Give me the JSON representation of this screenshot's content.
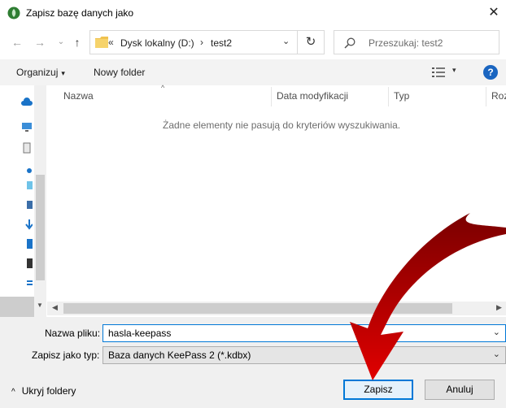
{
  "window": {
    "title": "Zapisz bazę danych jako",
    "close_glyph": "✕"
  },
  "address": {
    "overflow": "«",
    "crumbs": [
      "Dysk lokalny (D:)",
      "test2"
    ],
    "separator": "›",
    "dropdown_glyph": "⌄",
    "refresh_glyph": "↻"
  },
  "nav_glyphs": {
    "back": "←",
    "forward": "→",
    "recent": "⌄",
    "up": "↑"
  },
  "search": {
    "placeholder": "Przeszukaj: test2"
  },
  "toolbar": {
    "organize_label": "Organizuj",
    "new_folder_label": "Nowy folder",
    "help_glyph": "?",
    "caret": "▾"
  },
  "columns": {
    "name": "Nazwa",
    "modified": "Data modyfikacji",
    "type": "Typ",
    "size": "Roz"
  },
  "empty_message": "Żadne elementy nie pasują do kryteriów wyszukiwania.",
  "scroll_glyphs": {
    "left": "◀",
    "right": "▶",
    "down": "▼",
    "sort": "^"
  },
  "form": {
    "filename_label": "Nazwa pliku:",
    "filename_value": "hasla-keepass",
    "filetype_label": "Zapisz jako typ:",
    "filetype_value": "Baza danych KeePass 2 (*.kdbx)",
    "dropdown_glyph": "⌄"
  },
  "hide_folders": {
    "label": "Ukryj foldery",
    "caret": "^"
  },
  "buttons": {
    "save": "Zapisz",
    "cancel": "Anuluj"
  },
  "colors": {
    "accent": "#0078d7",
    "annotation_arrow": "#c00000",
    "help_icon": "#1a65c0",
    "folder": "#f0c24f"
  }
}
